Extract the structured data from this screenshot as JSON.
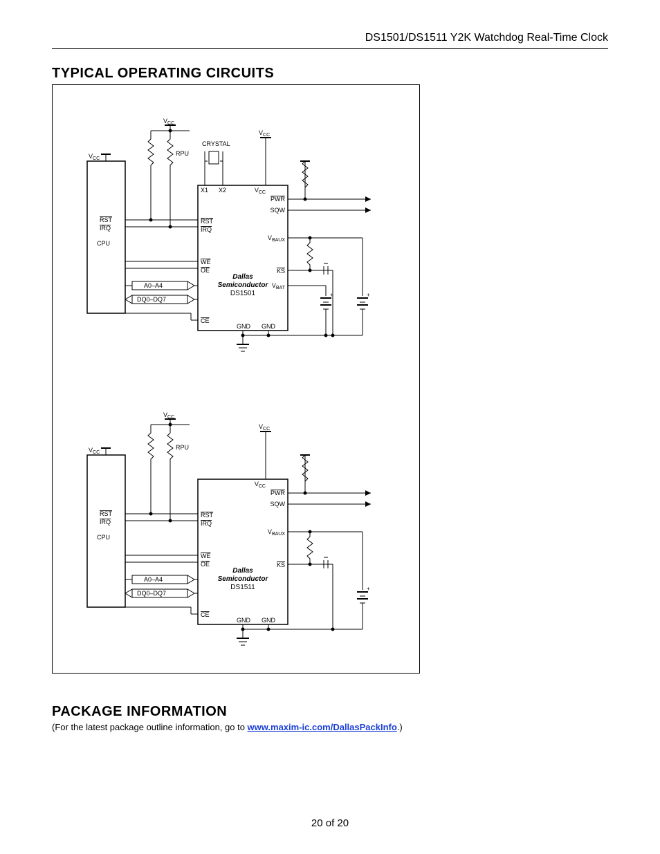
{
  "header": {
    "title": "DS1501/DS1511 Y2K Watchdog Real-Time Clock"
  },
  "sections": {
    "typical": "TYPICAL OPERATING CIRCUITS",
    "package": "PACKAGE INFORMATION",
    "package_note_prefix": "(For the latest package outline information, go to ",
    "package_link_text": "www.maxim-ic.com/DallasPackInfo",
    "package_note_suffix": ".)"
  },
  "footer": {
    "page": "20 of 20"
  },
  "diagram": {
    "common": {
      "vcc_left": "V",
      "vcc_left_sub": "CC",
      "vcc_mid": "V",
      "vcc_mid_sub": "CC",
      "vcc_right": "V",
      "vcc_right_sub": "CC",
      "rpu": "RPU",
      "cpu": "CPU",
      "rst": "RST",
      "irq": "IRQ",
      "we": "WE",
      "oe": "OE",
      "ce": "CE",
      "a": "A0–A4",
      "dq": "DQ0–DQ7",
      "pwr": "PWR",
      "sqw": "SQW",
      "vbaux": "V",
      "vbaux_sub": "BAUX",
      "ks": "KS",
      "vbat": "V",
      "vbat_sub": "BAT",
      "gnd": "GND",
      "dallas1": "Dallas",
      "dallas2": "Semiconductor"
    },
    "top": {
      "crystal": "CRYSTAL",
      "x1": "X1",
      "x2": "X2",
      "part": "DS1501"
    },
    "bottom": {
      "part": "DS1511"
    }
  }
}
